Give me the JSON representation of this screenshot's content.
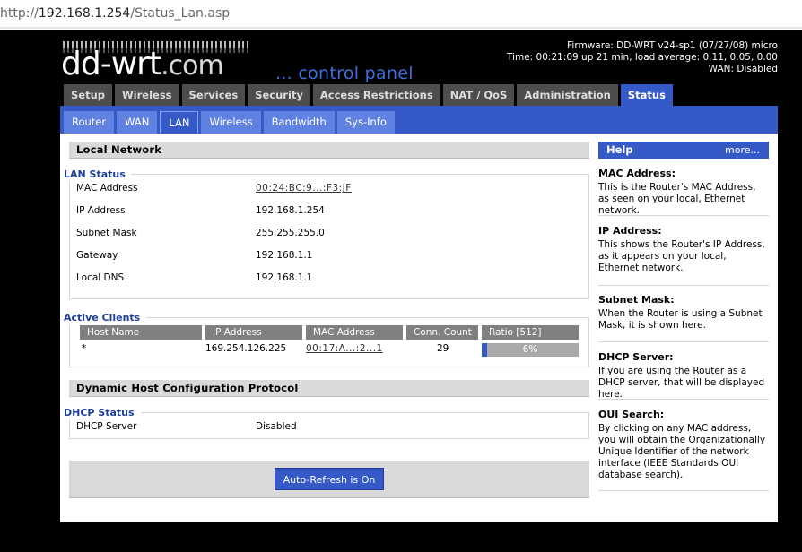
{
  "browser": {
    "url_prefix": "http://",
    "url_host": "192.168.1.254",
    "url_path": "/Status_Lan.asp"
  },
  "header": {
    "logo_main": "dd-wrt",
    "logo_suffix": ".com",
    "tagline": "... control panel",
    "firmware": "Firmware: DD-WRT v24-sp1 (07/27/08) micro",
    "time": "Time: 00:21:09 up 21 min, load average: 0.11, 0.05, 0.00",
    "wan": "WAN: Disabled"
  },
  "main_tabs": [
    "Setup",
    "Wireless",
    "Services",
    "Security",
    "Access Restrictions",
    "NAT / QoS",
    "Administration",
    "Status"
  ],
  "sub_tabs": [
    "Router",
    "WAN",
    "LAN",
    "Wireless",
    "Bandwidth",
    "Sys-Info"
  ],
  "local_network": {
    "title": "Local Network",
    "legend": "LAN Status",
    "rows": [
      {
        "label": "MAC Address",
        "value": "00:24:BC:9...:F3:JF"
      },
      {
        "label": "IP Address",
        "value": "192.168.1.254"
      },
      {
        "label": "Subnet Mask",
        "value": "255.255.255.0"
      },
      {
        "label": "Gateway",
        "value": "192.168.1.1"
      },
      {
        "label": "Local DNS",
        "value": "192.168.1.1"
      }
    ]
  },
  "active_clients": {
    "legend": "Active Clients",
    "headers": [
      "Host Name",
      "IP Address",
      "MAC Address",
      "Conn. Count",
      "Ratio [512]"
    ],
    "rows": [
      {
        "host": "*",
        "ip": "169.254.126.225",
        "mac": "00:17:A...:2...1",
        "count": "29",
        "ratio": "6%",
        "ratio_value": 0.06
      }
    ]
  },
  "dhcp": {
    "title": "Dynamic Host Configuration Protocol",
    "legend": "DHCP Status",
    "rows": [
      {
        "label": "DHCP Server",
        "value": "Disabled"
      }
    ]
  },
  "refresh_button": "Auto-Refresh is On",
  "help": {
    "title": "Help",
    "more": "more...",
    "items": [
      {
        "heading": "MAC Address:",
        "text": "This is the Router's MAC Address, as seen on your local, Ethernet network."
      },
      {
        "heading": "IP Address:",
        "text": "This shows the Router's IP Address, as it appears on your local, Ethernet network."
      },
      {
        "heading": "Subnet Mask:",
        "text": "When the Router is using a Subnet Mask, it is shown here."
      },
      {
        "heading": "DHCP Server:",
        "text": "If you are using the Router as a DHCP server, that will be displayed here."
      },
      {
        "heading": "OUI Search:",
        "text": "By clicking on any MAC address, you will obtain the Organizationally Unique Identifier of the network interface (IEEE Standards OUI database search)."
      }
    ]
  },
  "colors": {
    "accent": "#3559c6",
    "tab_inactive": "#4d4d4d",
    "legend_text": "#1e3f9a"
  }
}
